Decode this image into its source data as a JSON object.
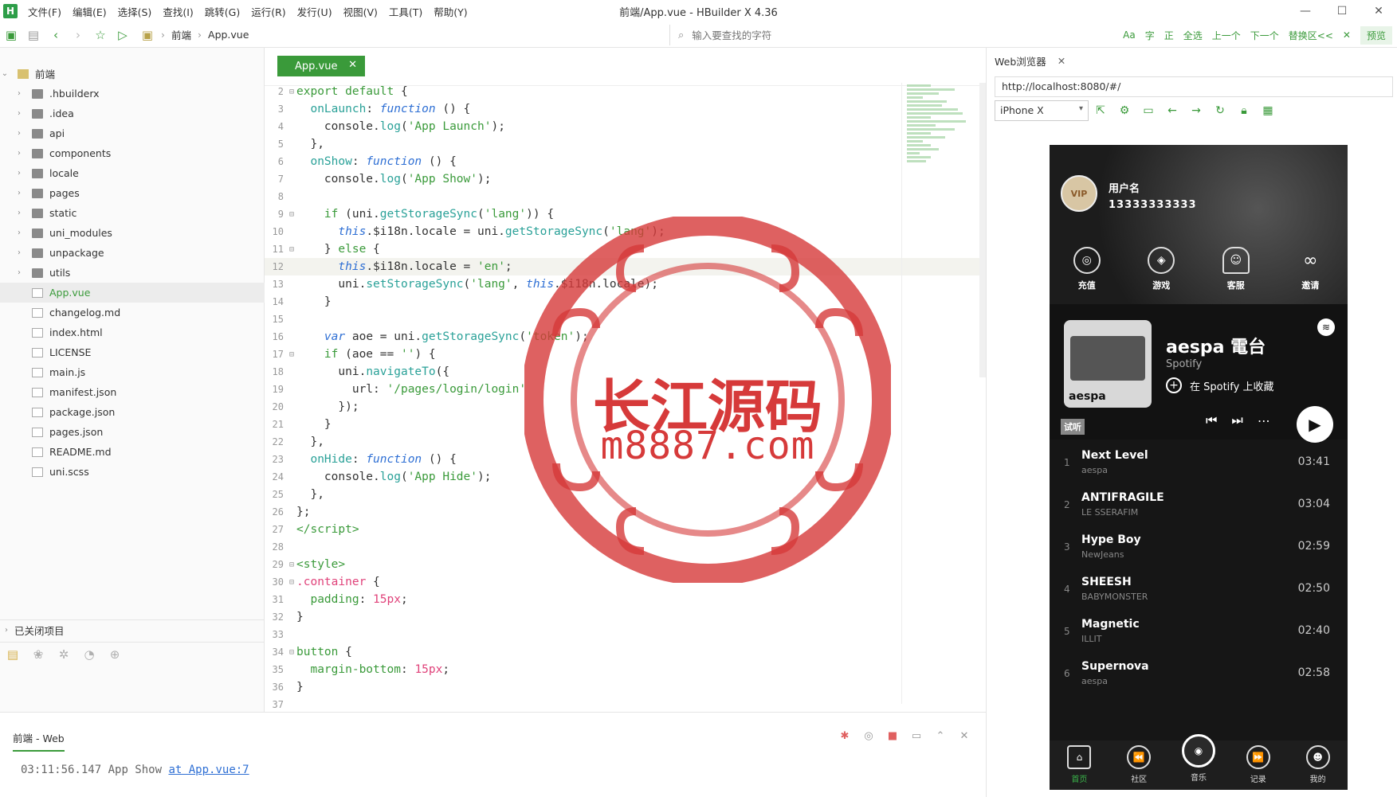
{
  "window": {
    "title": "前端/App.vue - HBuilder X 4.36",
    "menu": [
      "文件(F)",
      "编辑(E)",
      "选择(S)",
      "查找(I)",
      "跳转(G)",
      "运行(R)",
      "发行(U)",
      "视图(V)",
      "工具(T)",
      "帮助(Y)"
    ],
    "controls": {
      "minimize": "—",
      "maximize": "☐",
      "close": "✕"
    }
  },
  "toolbar": {
    "breadcrumb": [
      "前端",
      "App.vue"
    ],
    "search_placeholder": "输入要查找的字符",
    "find_tools": [
      "Aa",
      "字",
      "正",
      "全选",
      "上一个",
      "下一个",
      "替换区<<",
      "✕"
    ],
    "preview_label": "预览"
  },
  "sidebar": {
    "project": "前端",
    "items": [
      {
        "label": ".hbuilderx",
        "type": "folder"
      },
      {
        "label": ".idea",
        "type": "folder"
      },
      {
        "label": "api",
        "type": "folder"
      },
      {
        "label": "components",
        "type": "folder"
      },
      {
        "label": "locale",
        "type": "folder"
      },
      {
        "label": "pages",
        "type": "folder"
      },
      {
        "label": "static",
        "type": "folder"
      },
      {
        "label": "uni_modules",
        "type": "folder"
      },
      {
        "label": "unpackage",
        "type": "folder"
      },
      {
        "label": "utils",
        "type": "folder"
      },
      {
        "label": "App.vue",
        "type": "file",
        "selected": true
      },
      {
        "label": "changelog.md",
        "type": "file"
      },
      {
        "label": "index.html",
        "type": "file"
      },
      {
        "label": "LICENSE",
        "type": "file"
      },
      {
        "label": "main.js",
        "type": "file"
      },
      {
        "label": "manifest.json",
        "type": "file"
      },
      {
        "label": "package.json",
        "type": "file"
      },
      {
        "label": "pages.json",
        "type": "file"
      },
      {
        "label": "README.md",
        "type": "file"
      },
      {
        "label": "uni.scss",
        "type": "file"
      }
    ],
    "closed_projects": "已关闭项目"
  },
  "editor": {
    "tab_label": "App.vue",
    "lines": [
      {
        "n": "2",
        "fold": "⊟",
        "html": "<span class=k>export default</span> {"
      },
      {
        "n": "3",
        "fold": "",
        "html": "  <span class=f>onLaunch</span>: <span class=i>function</span> () {"
      },
      {
        "n": "4",
        "fold": "",
        "html": "    console.<span class=f>log</span>(<span class=s>'App Launch'</span>);"
      },
      {
        "n": "5",
        "fold": "",
        "html": "  },"
      },
      {
        "n": "6",
        "fold": "",
        "html": "  <span class=f>onShow</span>: <span class=i>function</span> () {"
      },
      {
        "n": "7",
        "fold": "",
        "html": "    console.<span class=f>log</span>(<span class=s>'App Show'</span>);"
      },
      {
        "n": "8",
        "fold": "",
        "html": ""
      },
      {
        "n": "9",
        "fold": "⊟",
        "html": "    <span class=k>if</span> (uni.<span class=f>getStorageSync</span>(<span class=s>'lang'</span>)) {"
      },
      {
        "n": "10",
        "fold": "",
        "html": "      <span class=i>this</span>.$i18n.locale = uni.<span class=f>getStorageSync</span>(<span class=s>'lang'</span>);"
      },
      {
        "n": "11",
        "fold": "⊟",
        "html": "    } <span class=k>else</span> {"
      },
      {
        "n": "12",
        "fold": "",
        "html": "      <span class=i>this</span>.$i18n.locale = <span class=s>'en'</span>;",
        "hl": true
      },
      {
        "n": "13",
        "fold": "",
        "html": "      uni.<span class=f>setStorageSync</span>(<span class=s>'lang'</span>, <span class=i>this</span>.$i18n.locale);"
      },
      {
        "n": "14",
        "fold": "",
        "html": "    }"
      },
      {
        "n": "15",
        "fold": "",
        "html": ""
      },
      {
        "n": "16",
        "fold": "",
        "html": "    <span class=i>var</span> aoe = uni.<span class=f>getStorageSync</span>(<span class=s>'token'</span>);"
      },
      {
        "n": "17",
        "fold": "⊟",
        "html": "    <span class=k>if</span> (aoe == <span class=s>''</span>) {"
      },
      {
        "n": "18",
        "fold": "",
        "html": "      uni.<span class=f>navigateTo</span>({"
      },
      {
        "n": "19",
        "fold": "",
        "html": "        url: <span class=s>'/pages/login/login'</span>"
      },
      {
        "n": "20",
        "fold": "",
        "html": "      });"
      },
      {
        "n": "21",
        "fold": "",
        "html": "    }"
      },
      {
        "n": "22",
        "fold": "",
        "html": "  },"
      },
      {
        "n": "23",
        "fold": "",
        "html": "  <span class=f>onHide</span>: <span class=i>function</span> () {"
      },
      {
        "n": "24",
        "fold": "",
        "html": "    console.<span class=f>log</span>(<span class=s>'App Hide'</span>);"
      },
      {
        "n": "25",
        "fold": "",
        "html": "  },"
      },
      {
        "n": "26",
        "fold": "",
        "html": "};"
      },
      {
        "n": "27",
        "fold": "",
        "html": "<span class=t>&lt;/script&gt;</span>"
      },
      {
        "n": "28",
        "fold": "",
        "html": ""
      },
      {
        "n": "29",
        "fold": "⊟",
        "html": "<span class=t>&lt;style&gt;</span>"
      },
      {
        "n": "30",
        "fold": "⊟",
        "html": "<span class=n>.container</span> {"
      },
      {
        "n": "31",
        "fold": "",
        "html": "  <span class=k>padding</span>: <span class=n>15px</span>;"
      },
      {
        "n": "32",
        "fold": "",
        "html": "}"
      },
      {
        "n": "33",
        "fold": "",
        "html": ""
      },
      {
        "n": "34",
        "fold": "⊟",
        "html": "<span class=k>button</span> {"
      },
      {
        "n": "35",
        "fold": "",
        "html": "  <span class=k>margin-bottom</span>: <span class=n>15px</span>;"
      },
      {
        "n": "36",
        "fold": "",
        "html": "}"
      },
      {
        "n": "37",
        "fold": "",
        "html": ""
      }
    ]
  },
  "watermark": {
    "line1": "长江源码",
    "line2": "m8887.com"
  },
  "console": {
    "tab": "前端 - Web",
    "time": "03:11:56.147",
    "text": "App Show",
    "link": "at App.vue:7"
  },
  "browser": {
    "tab": "Web浏览器",
    "url": "http://localhost:8080/#/",
    "device": "iPhone X"
  },
  "app": {
    "username": "用户名",
    "phone": "13333333333",
    "avatar_text": "VIP",
    "quick": [
      "充值",
      "游戏",
      "客服",
      "邀请"
    ],
    "card": {
      "cover_label": "aespa",
      "title": "aespa 電台",
      "subtitle": "Spotify",
      "save": "在 Spotify 上收藏",
      "trial": "试听"
    },
    "tracks": [
      {
        "no": "1",
        "name": "Next Level",
        "artist": "aespa",
        "dur": "03:41"
      },
      {
        "no": "2",
        "name": "ANTIFRAGILE",
        "artist": "LE SSERAFIM",
        "dur": "03:04"
      },
      {
        "no": "3",
        "name": "Hype Boy",
        "artist": "NewJeans",
        "dur": "02:59"
      },
      {
        "no": "4",
        "name": "SHEESH",
        "artist": "BABYMONSTER",
        "dur": "02:50"
      },
      {
        "no": "5",
        "name": "Magnetic",
        "artist": "ILLIT",
        "dur": "02:40"
      },
      {
        "no": "6",
        "name": "Supernova",
        "artist": "aespa",
        "dur": "02:58"
      }
    ],
    "tabs": [
      "首页",
      "社区",
      "音乐",
      "记录",
      "我的"
    ]
  }
}
